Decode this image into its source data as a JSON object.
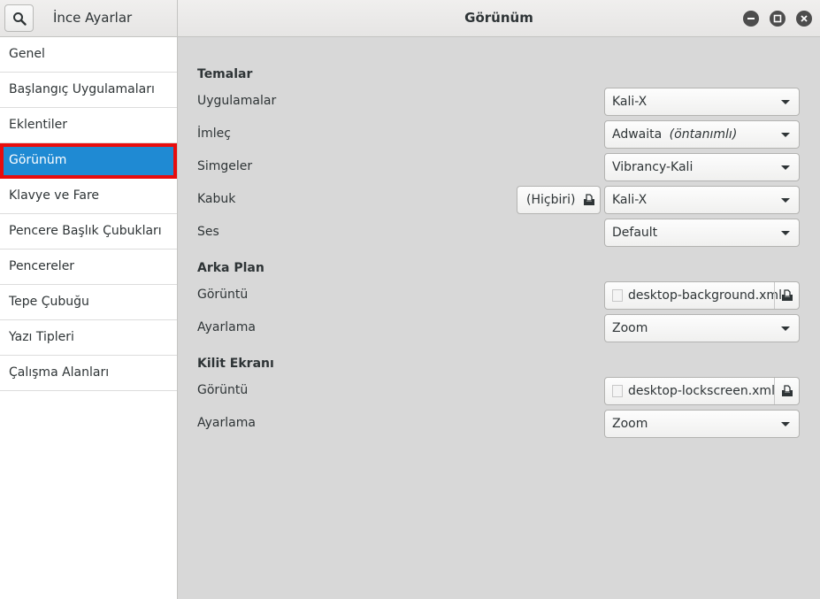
{
  "header": {
    "app_title": "İnce Ayarlar",
    "page_title": "Görünüm"
  },
  "sidebar": {
    "items": [
      {
        "label": "Genel"
      },
      {
        "label": "Başlangıç Uygulamaları"
      },
      {
        "label": "Eklentiler"
      },
      {
        "label": "Görünüm",
        "selected": true
      },
      {
        "label": "Klavye ve Fare"
      },
      {
        "label": "Pencere Başlık Çubukları"
      },
      {
        "label": "Pencereler"
      },
      {
        "label": "Tepe Çubuğu"
      },
      {
        "label": "Yazı Tipleri"
      },
      {
        "label": "Çalışma Alanları"
      }
    ]
  },
  "themes": {
    "title": "Temalar",
    "applications": {
      "label": "Uygulamalar",
      "value": "Kali-X"
    },
    "cursor": {
      "label": "İmleç",
      "value": "Adwaita",
      "default_note": "(öntanımlı)"
    },
    "icons": {
      "label": "Simgeler",
      "value": "Vibrancy-Kali"
    },
    "shell": {
      "label": "Kabuk",
      "file_value": "(Hiçbiri)",
      "value": "Kali-X"
    },
    "sound": {
      "label": "Ses",
      "value": "Default"
    }
  },
  "background": {
    "title": "Arka Plan",
    "image": {
      "label": "Görüntü",
      "value": "desktop-background.xml"
    },
    "adjustment": {
      "label": "Ayarlama",
      "value": "Zoom"
    }
  },
  "lockscreen": {
    "title": "Kilit Ekranı",
    "image": {
      "label": "Görüntü",
      "value": "desktop-lockscreen.xml"
    },
    "adjustment": {
      "label": "Ayarlama",
      "value": "Zoom"
    }
  },
  "colors": {
    "accent": "#1f8ad3",
    "highlight_border": "#e80d0d"
  }
}
